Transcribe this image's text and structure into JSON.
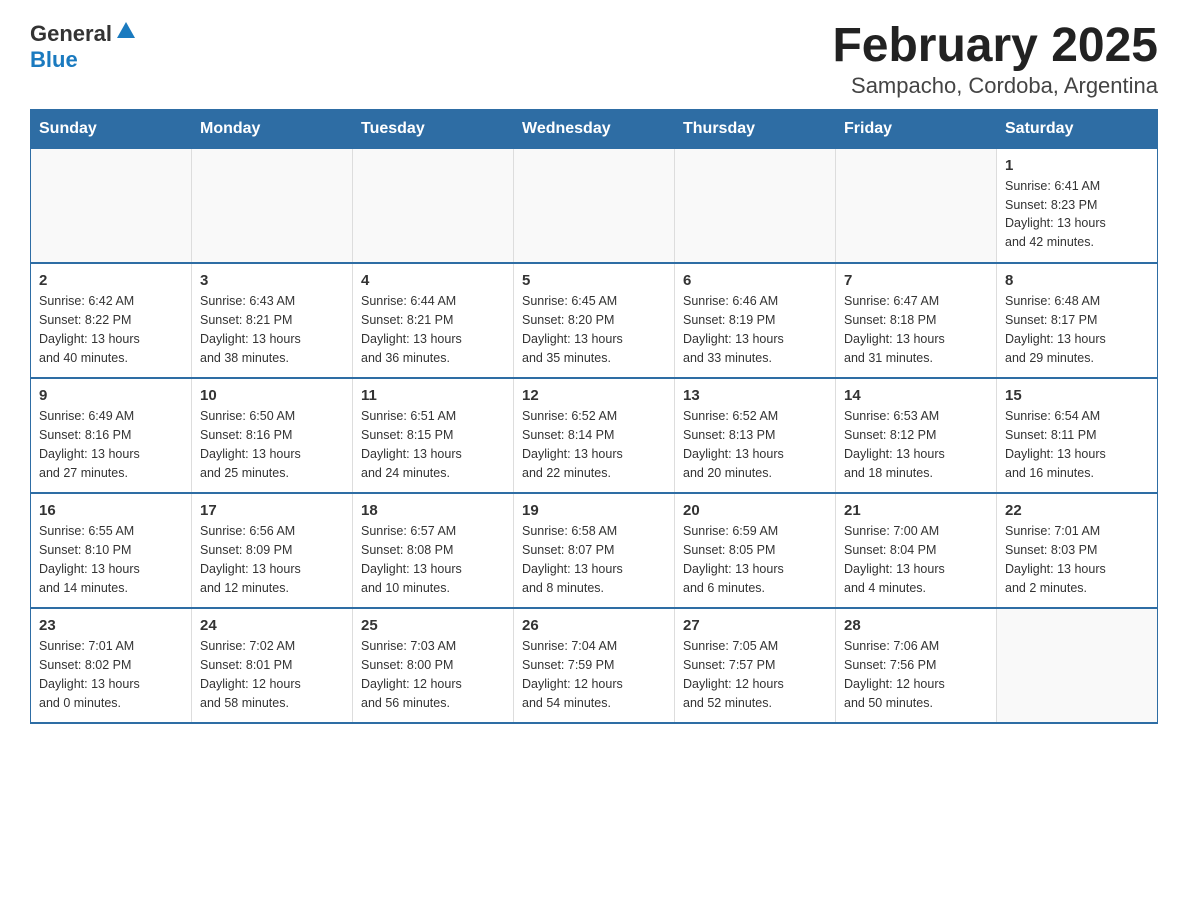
{
  "header": {
    "logo_general": "General",
    "logo_blue": "Blue",
    "title": "February 2025",
    "subtitle": "Sampacho, Cordoba, Argentina"
  },
  "days_of_week": [
    "Sunday",
    "Monday",
    "Tuesday",
    "Wednesday",
    "Thursday",
    "Friday",
    "Saturday"
  ],
  "weeks": [
    {
      "days": [
        {
          "number": "",
          "info": ""
        },
        {
          "number": "",
          "info": ""
        },
        {
          "number": "",
          "info": ""
        },
        {
          "number": "",
          "info": ""
        },
        {
          "number": "",
          "info": ""
        },
        {
          "number": "",
          "info": ""
        },
        {
          "number": "1",
          "info": "Sunrise: 6:41 AM\nSunset: 8:23 PM\nDaylight: 13 hours\nand 42 minutes."
        }
      ]
    },
    {
      "days": [
        {
          "number": "2",
          "info": "Sunrise: 6:42 AM\nSunset: 8:22 PM\nDaylight: 13 hours\nand 40 minutes."
        },
        {
          "number": "3",
          "info": "Sunrise: 6:43 AM\nSunset: 8:21 PM\nDaylight: 13 hours\nand 38 minutes."
        },
        {
          "number": "4",
          "info": "Sunrise: 6:44 AM\nSunset: 8:21 PM\nDaylight: 13 hours\nand 36 minutes."
        },
        {
          "number": "5",
          "info": "Sunrise: 6:45 AM\nSunset: 8:20 PM\nDaylight: 13 hours\nand 35 minutes."
        },
        {
          "number": "6",
          "info": "Sunrise: 6:46 AM\nSunset: 8:19 PM\nDaylight: 13 hours\nand 33 minutes."
        },
        {
          "number": "7",
          "info": "Sunrise: 6:47 AM\nSunset: 8:18 PM\nDaylight: 13 hours\nand 31 minutes."
        },
        {
          "number": "8",
          "info": "Sunrise: 6:48 AM\nSunset: 8:17 PM\nDaylight: 13 hours\nand 29 minutes."
        }
      ]
    },
    {
      "days": [
        {
          "number": "9",
          "info": "Sunrise: 6:49 AM\nSunset: 8:16 PM\nDaylight: 13 hours\nand 27 minutes."
        },
        {
          "number": "10",
          "info": "Sunrise: 6:50 AM\nSunset: 8:16 PM\nDaylight: 13 hours\nand 25 minutes."
        },
        {
          "number": "11",
          "info": "Sunrise: 6:51 AM\nSunset: 8:15 PM\nDaylight: 13 hours\nand 24 minutes."
        },
        {
          "number": "12",
          "info": "Sunrise: 6:52 AM\nSunset: 8:14 PM\nDaylight: 13 hours\nand 22 minutes."
        },
        {
          "number": "13",
          "info": "Sunrise: 6:52 AM\nSunset: 8:13 PM\nDaylight: 13 hours\nand 20 minutes."
        },
        {
          "number": "14",
          "info": "Sunrise: 6:53 AM\nSunset: 8:12 PM\nDaylight: 13 hours\nand 18 minutes."
        },
        {
          "number": "15",
          "info": "Sunrise: 6:54 AM\nSunset: 8:11 PM\nDaylight: 13 hours\nand 16 minutes."
        }
      ]
    },
    {
      "days": [
        {
          "number": "16",
          "info": "Sunrise: 6:55 AM\nSunset: 8:10 PM\nDaylight: 13 hours\nand 14 minutes."
        },
        {
          "number": "17",
          "info": "Sunrise: 6:56 AM\nSunset: 8:09 PM\nDaylight: 13 hours\nand 12 minutes."
        },
        {
          "number": "18",
          "info": "Sunrise: 6:57 AM\nSunset: 8:08 PM\nDaylight: 13 hours\nand 10 minutes."
        },
        {
          "number": "19",
          "info": "Sunrise: 6:58 AM\nSunset: 8:07 PM\nDaylight: 13 hours\nand 8 minutes."
        },
        {
          "number": "20",
          "info": "Sunrise: 6:59 AM\nSunset: 8:05 PM\nDaylight: 13 hours\nand 6 minutes."
        },
        {
          "number": "21",
          "info": "Sunrise: 7:00 AM\nSunset: 8:04 PM\nDaylight: 13 hours\nand 4 minutes."
        },
        {
          "number": "22",
          "info": "Sunrise: 7:01 AM\nSunset: 8:03 PM\nDaylight: 13 hours\nand 2 minutes."
        }
      ]
    },
    {
      "days": [
        {
          "number": "23",
          "info": "Sunrise: 7:01 AM\nSunset: 8:02 PM\nDaylight: 13 hours\nand 0 minutes."
        },
        {
          "number": "24",
          "info": "Sunrise: 7:02 AM\nSunset: 8:01 PM\nDaylight: 12 hours\nand 58 minutes."
        },
        {
          "number": "25",
          "info": "Sunrise: 7:03 AM\nSunset: 8:00 PM\nDaylight: 12 hours\nand 56 minutes."
        },
        {
          "number": "26",
          "info": "Sunrise: 7:04 AM\nSunset: 7:59 PM\nDaylight: 12 hours\nand 54 minutes."
        },
        {
          "number": "27",
          "info": "Sunrise: 7:05 AM\nSunset: 7:57 PM\nDaylight: 12 hours\nand 52 minutes."
        },
        {
          "number": "28",
          "info": "Sunrise: 7:06 AM\nSunset: 7:56 PM\nDaylight: 12 hours\nand 50 minutes."
        },
        {
          "number": "",
          "info": ""
        }
      ]
    }
  ]
}
